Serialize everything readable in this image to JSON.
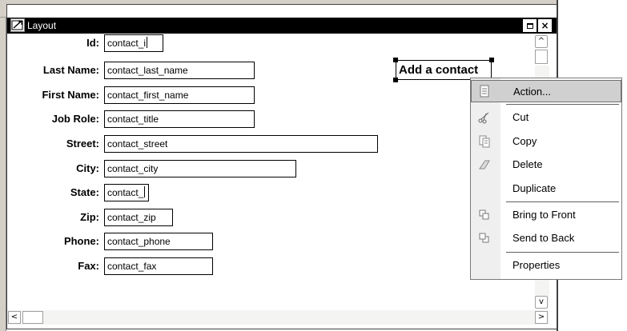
{
  "window": {
    "title": "Layout",
    "maximize_label": "",
    "close_label": "×"
  },
  "form": {
    "fields": [
      {
        "label": "Id:",
        "value": "contact_i"
      },
      {
        "label": "Last Name:",
        "value": "contact_last_name"
      },
      {
        "label": "First Name:",
        "value": "contact_first_name"
      },
      {
        "label": "Job Role:",
        "value": "contact_title"
      },
      {
        "label": "Street:",
        "value": "contact_street"
      },
      {
        "label": "City:",
        "value": "contact_city"
      },
      {
        "label": "State:",
        "value": "contact_"
      },
      {
        "label": "Zip:",
        "value": "contact_zip"
      },
      {
        "label": "Phone:",
        "value": "contact_phone"
      },
      {
        "label": "Fax:",
        "value": "contact_fax"
      }
    ],
    "add_button_label": "Add a contact"
  },
  "context_menu": {
    "items": [
      {
        "label": "Action...",
        "icon": "action-icon",
        "highlighted": true
      },
      {
        "label": "Cut",
        "icon": "scissors-icon"
      },
      {
        "label": "Copy",
        "icon": "copy-icon"
      },
      {
        "label": "Delete",
        "icon": "eraser-icon"
      },
      {
        "label": "Duplicate",
        "icon": ""
      },
      {
        "label": "Bring to Front",
        "icon": "bring-to-front-icon"
      },
      {
        "label": "Send to Back",
        "icon": "send-to-back-icon"
      },
      {
        "label": "Properties",
        "icon": ""
      }
    ]
  },
  "scrollbars": {
    "up_arrow": "^",
    "down_arrow": "v",
    "left_arrow": "<",
    "right_arrow": ">"
  },
  "colors": {
    "titlebar": "#000000",
    "menu_highlight": "#d0d0d0",
    "frame": "#d4d0c8"
  }
}
